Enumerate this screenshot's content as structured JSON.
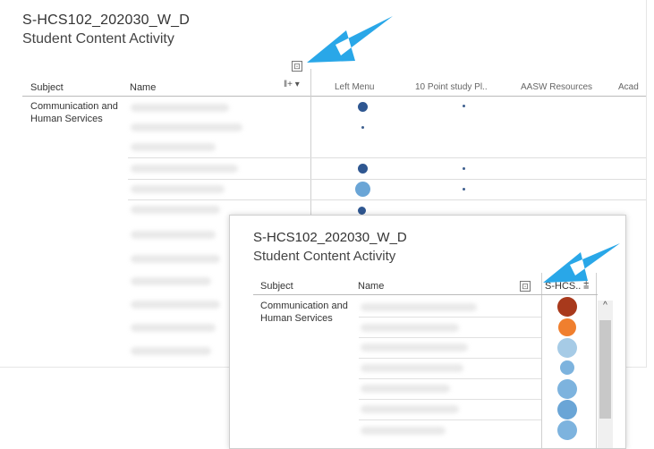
{
  "back_panel": {
    "title": "S-HCS102_202030_W_D",
    "subtitle": "Student Content Activity",
    "expand_symbol": "⊡",
    "headers": {
      "subject": "Subject",
      "name": "Name",
      "sort": "‖+ ▾",
      "col1": "Left Menu",
      "col2": "10 Point study Pl..",
      "col3": "AASW Resources",
      "col4": "Acad"
    },
    "subject_value": "Communication and Human Services"
  },
  "front_panel": {
    "title": "S-HCS102_202030_W_D",
    "subtitle": "Student Content Activity",
    "expand_symbol": "⊡",
    "headers": {
      "subject": "Subject",
      "name": "Name",
      "col1": "S-HCS..",
      "sort": "⩲"
    },
    "subject_value": "Communication and Human Services",
    "scroll_up": "^"
  },
  "colors": {
    "arrow": "#29a7e8",
    "dark_blue": "#2f5791",
    "mid_blue": "#6aa5d6",
    "light_blue": "#a6cbe6",
    "rust": "#a8391c",
    "orange": "#f07f2e"
  },
  "icons": [
    "expand-icon",
    "sort-icon",
    "scroll-up-icon",
    "arrow-pointer-icon"
  ]
}
